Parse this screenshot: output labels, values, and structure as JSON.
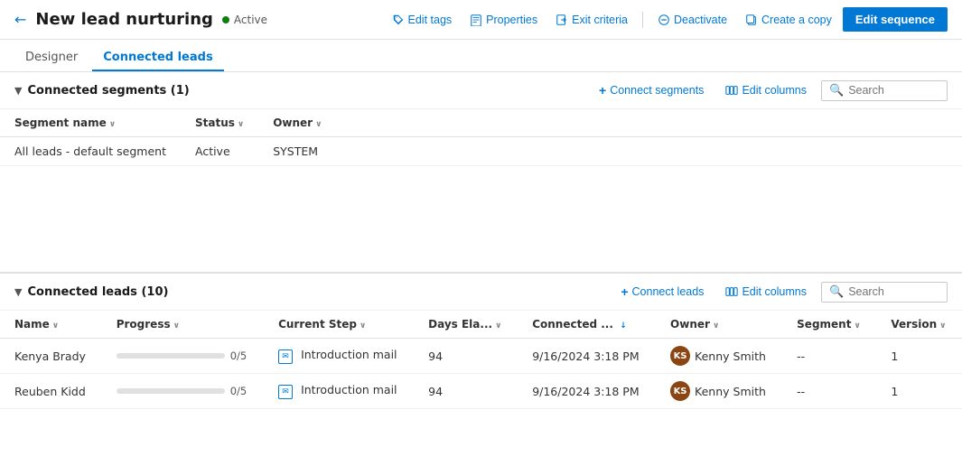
{
  "header": {
    "back_label": "←",
    "title": "New lead nurturing",
    "status": "Active",
    "status_color": "#107c10",
    "actions": [
      {
        "id": "edit-tags",
        "label": "Edit tags",
        "icon": "tag"
      },
      {
        "id": "properties",
        "label": "Properties",
        "icon": "doc"
      },
      {
        "id": "exit-criteria",
        "label": "Exit criteria",
        "icon": "exit"
      },
      {
        "id": "deactivate",
        "label": "Deactivate",
        "icon": "deactivate"
      },
      {
        "id": "create-copy",
        "label": "Create a copy",
        "icon": "copy"
      }
    ],
    "primary_btn": "Edit sequence"
  },
  "tabs": [
    {
      "id": "designer",
      "label": "Designer"
    },
    {
      "id": "connected-leads",
      "label": "Connected leads",
      "active": true
    }
  ],
  "segments_section": {
    "title": "Connected segments",
    "count": 1,
    "actions": {
      "connect": "Connect segments",
      "edit_columns": "Edit columns",
      "search_placeholder": "Search"
    },
    "columns": [
      {
        "label": "Segment name",
        "sortable": true
      },
      {
        "label": "Status",
        "sortable": true
      },
      {
        "label": "Owner",
        "sortable": true
      }
    ],
    "rows": [
      {
        "segment_name": "All leads - default segment",
        "status": "Active",
        "owner": "SYSTEM"
      }
    ]
  },
  "leads_section": {
    "title": "Connected leads",
    "count": 10,
    "actions": {
      "connect": "Connect leads",
      "edit_columns": "Edit columns",
      "search_placeholder": "Search"
    },
    "columns": [
      {
        "label": "Name",
        "sortable": true
      },
      {
        "label": "Progress",
        "sortable": true
      },
      {
        "label": "Current Step",
        "sortable": true
      },
      {
        "label": "Days Ela...",
        "sortable": true
      },
      {
        "label": "Connected ...",
        "sortable": true,
        "sort_dir": "desc"
      },
      {
        "label": "Owner",
        "sortable": true
      },
      {
        "label": "Segment",
        "sortable": true
      },
      {
        "label": "Version",
        "sortable": true
      }
    ],
    "rows": [
      {
        "name": "Kenya Brady",
        "progress_value": 0,
        "progress_max": 5,
        "progress_label": "0/5",
        "current_step": "Introduction mail",
        "days_elapsed": "94",
        "connected_date": "9/16/2024 3:18 PM",
        "owner_initials": "KS",
        "owner_name": "Kenny Smith",
        "segment": "--",
        "version": "1"
      },
      {
        "name": "Reuben Kidd",
        "progress_value": 0,
        "progress_max": 5,
        "progress_label": "0/5",
        "current_step": "Introduction mail",
        "days_elapsed": "94",
        "connected_date": "9/16/2024 3:18 PM",
        "owner_initials": "KS",
        "owner_name": "Kenny Smith",
        "segment": "--",
        "version": "1"
      }
    ]
  }
}
